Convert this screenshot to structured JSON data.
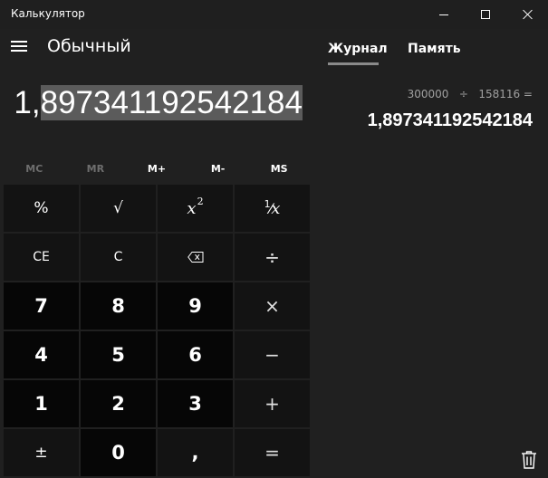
{
  "window": {
    "title": "Калькулятор"
  },
  "header": {
    "mode_title": "Обычный",
    "menu_icon": "hamburger-icon"
  },
  "display": {
    "value_first": "1,",
    "value_selected": "897341192542184"
  },
  "memory": {
    "buttons": [
      {
        "label": "MC",
        "enabled": false
      },
      {
        "label": "MR",
        "enabled": false
      },
      {
        "label": "M+",
        "enabled": true
      },
      {
        "label": "M-",
        "enabled": true
      },
      {
        "label": "MS",
        "enabled": true
      }
    ]
  },
  "keys": {
    "percent": "%",
    "sqrt": "√",
    "square_x": "x",
    "square_2": "2",
    "inverse_1": "1",
    "inverse_slash": "⁄",
    "inverse_x": "x",
    "ce": "CE",
    "c": "C",
    "backspace_icon": "backspace-icon",
    "divide": "÷",
    "seven": "7",
    "eight": "8",
    "nine": "9",
    "multiply": "×",
    "four": "4",
    "five": "5",
    "six": "6",
    "minus": "−",
    "one": "1",
    "two": "2",
    "three": "3",
    "plus": "+",
    "negate": "±",
    "zero": "0",
    "decimal": ",",
    "equals": "="
  },
  "panel": {
    "tabs": [
      "Журнал",
      "Память"
    ],
    "active_tab": "Журнал",
    "history": [
      {
        "expression": "300000   ÷   158116 =",
        "result": "1,897341192542184"
      }
    ],
    "trash_icon": "trash-icon"
  },
  "colors": {
    "background": "#202020",
    "number_key": "#060606",
    "function_key": "#131313",
    "selection": "#5b5b5b"
  }
}
